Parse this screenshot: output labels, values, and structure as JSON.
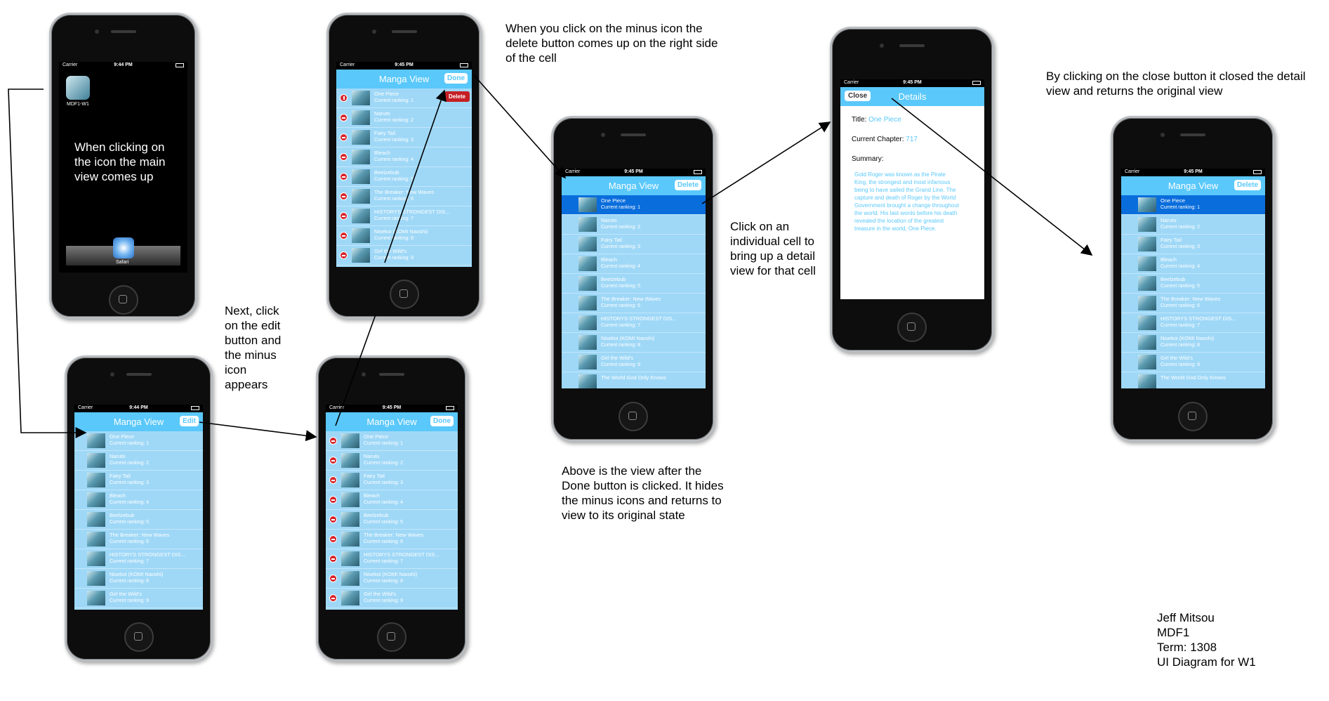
{
  "status": {
    "carrier": "Carrier",
    "time_a": "9:44 PM",
    "time_b": "9:45 PM"
  },
  "home": {
    "app_label": "MDF1-W1",
    "dock_label": "Safari"
  },
  "nav": {
    "title": "Manga View",
    "edit": "Edit",
    "done": "Done",
    "delete": "Delete",
    "close": "Close",
    "details": "Details"
  },
  "cells": [
    {
      "title": "One Piece",
      "rank": "Current ranking:   1"
    },
    {
      "title": "Naruto",
      "rank": "Current ranking:   2"
    },
    {
      "title": "Fairy Tail",
      "rank": "Current ranking:   3"
    },
    {
      "title": "Bleach",
      "rank": "Current ranking:   4"
    },
    {
      "title": "Beelzebub",
      "rank": "Current ranking:   5"
    },
    {
      "title": "The Breaker: New Waves",
      "rank": "Current ranking:   6"
    },
    {
      "title": "HISTORYS STRONGEST DIS...",
      "rank": "Current ranking:   7"
    },
    {
      "title": "Nisekoi (KOMI Naoshi)",
      "rank": "Current ranking:   8"
    },
    {
      "title": "Girl the Wild's",
      "rank": "Current ranking:   9"
    },
    {
      "title": "The World God Only Knows",
      "rank": ""
    }
  ],
  "delete_button": "Delete",
  "detail": {
    "title_label": "Title:",
    "title_value": "One Piece",
    "chapter_label": "Current Chapter:",
    "chapter_value": "717",
    "summary_label": "Summary:",
    "summary_text": "Gold Roger was known as the Pirate King, the strongest and most infamous being to have sailed the Grand Line. The capture and death of Roger by the World Government brought a change throughout the world. His last words before his death revealed the location of the greatest treasure in the world, One Piece."
  },
  "notes": {
    "home_note": "When clicking on the icon the main view comes up",
    "edit_note": "Next, click on the edit button and the minus icon appears",
    "minus_note": "When you click on the minus icon the delete button comes up on the right side of the cell",
    "done_note": "Above is the view after the Done button is clicked. It hides the minus icons and returns to view to its original state",
    "cell_note": "Click on an individual cell to bring up a detail view for that cell",
    "close_note": "By clicking on the close button it closed the detail view and returns the original view"
  },
  "credits": {
    "name": "Jeff Mitsou",
    "course": "MDF1",
    "term": "Term: 1308",
    "title": "UI Diagram for W1"
  }
}
